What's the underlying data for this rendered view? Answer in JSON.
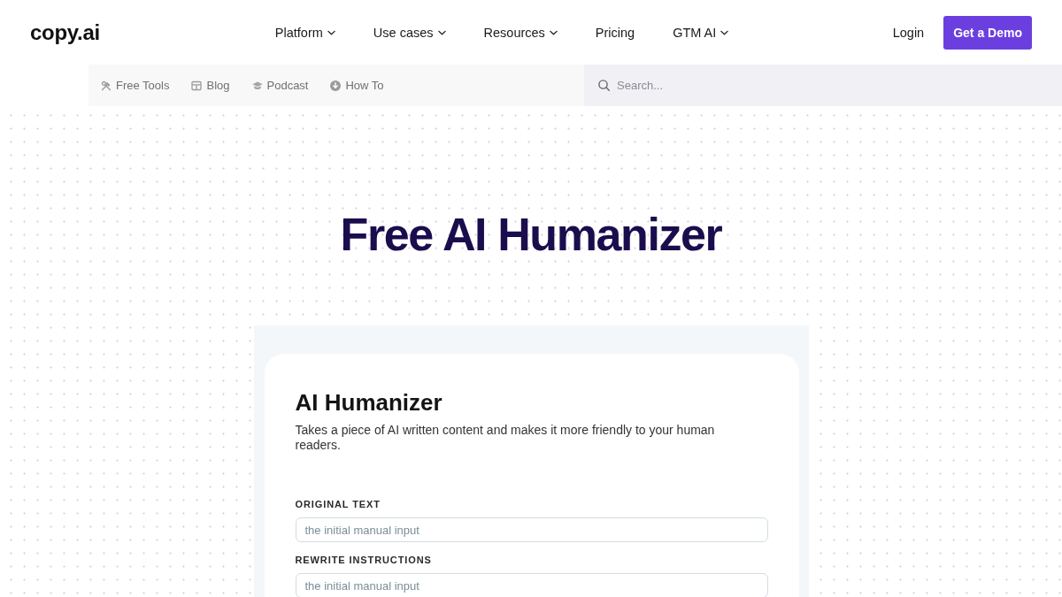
{
  "header": {
    "logo": "copy.ai",
    "nav": [
      {
        "label": "Platform",
        "has_menu": true
      },
      {
        "label": "Use cases",
        "has_menu": true
      },
      {
        "label": "Resources",
        "has_menu": true
      },
      {
        "label": "Pricing",
        "has_menu": false
      },
      {
        "label": "GTM AI",
        "has_menu": true
      }
    ],
    "login": "Login",
    "cta": "Get a Demo"
  },
  "subnav": {
    "links": [
      {
        "label": "Free Tools"
      },
      {
        "label": "Blog"
      },
      {
        "label": "Podcast"
      },
      {
        "label": "How To"
      }
    ],
    "search": {
      "placeholder": "Search..."
    }
  },
  "hero": {
    "title": "Free AI Humanizer"
  },
  "tool": {
    "title": "AI Humanizer",
    "description": "Takes a piece of AI written content and makes it more friendly to your human readers.",
    "fields": [
      {
        "label": "ORIGINAL TEXT",
        "placeholder": "the initial manual input"
      },
      {
        "label": "REWRITE INSTRUCTIONS",
        "placeholder": "the initial manual input"
      }
    ]
  }
}
